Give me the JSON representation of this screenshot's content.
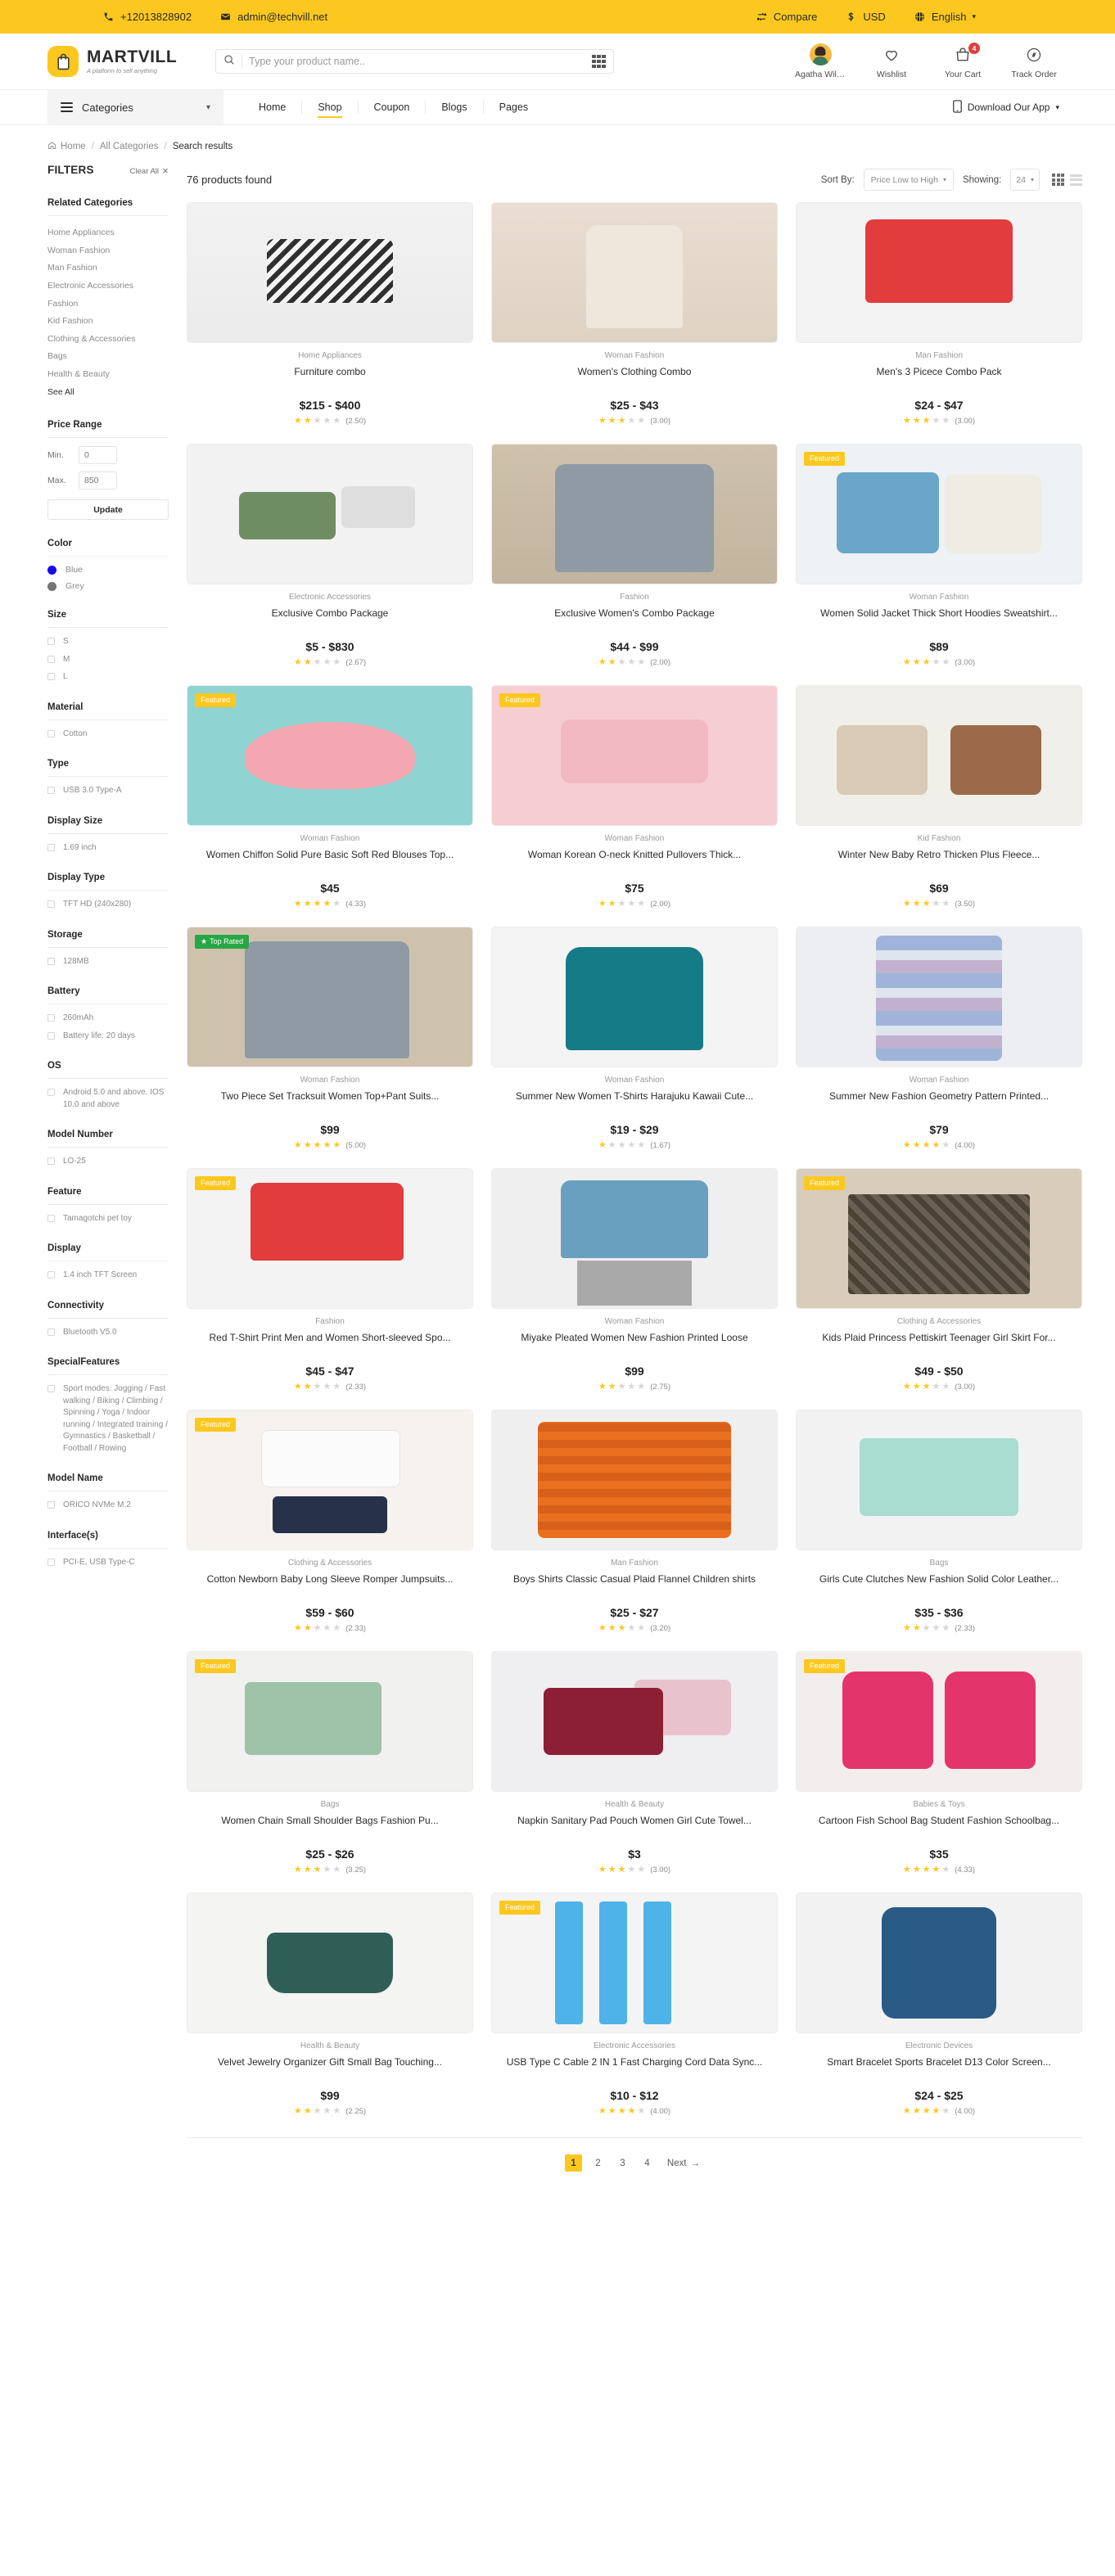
{
  "topbar": {
    "phone": "+12013828902",
    "email": "admin@techvill.net",
    "compare": "Compare",
    "currency": "USD",
    "language": "English"
  },
  "brand": {
    "name": "MARTVILL",
    "tagline": "A platform to sell anything"
  },
  "search": {
    "placeholder": "Type your product name..",
    "value": ""
  },
  "header_actions": [
    {
      "name": "account",
      "label": "Agatha Willia...",
      "icon": "avatar-icon",
      "badge": ""
    },
    {
      "name": "wishlist",
      "label": "Wishlist",
      "icon": "heart-icon",
      "badge": ""
    },
    {
      "name": "cart",
      "label": "Your Cart",
      "icon": "cart-icon",
      "badge": "4"
    },
    {
      "name": "track-order",
      "label": "Track Order",
      "icon": "compass-icon",
      "badge": ""
    }
  ],
  "nav": {
    "categories_label": "Categories",
    "links": [
      {
        "label": "Home",
        "active": false
      },
      {
        "label": "Shop",
        "active": true
      },
      {
        "label": "Coupon",
        "active": false
      },
      {
        "label": "Blogs",
        "active": false
      },
      {
        "label": "Pages",
        "active": false
      }
    ],
    "download_label": "Download Our App"
  },
  "breadcrumb": [
    {
      "label": "Home",
      "current": false
    },
    {
      "label": "All Categories",
      "current": false
    },
    {
      "label": "Search results",
      "current": true
    }
  ],
  "filters": {
    "title": "FILTERS",
    "clear_all": "Clear All",
    "related_categories": {
      "title": "Related Categories",
      "items": [
        "Home Appliances",
        "Woman Fashion",
        "Man Fashion",
        "Electronic Accessories",
        "Fashion",
        "Kid Fashion",
        "Clothing & Accessories",
        "Bags",
        "Health & Beauty"
      ],
      "see_all": "See All"
    },
    "price_range": {
      "title": "Price Range",
      "min_label": "Min.",
      "min_value": "0",
      "max_label": "Max.",
      "max_value": "850",
      "update_label": "Update"
    },
    "color": {
      "title": "Color",
      "items": [
        {
          "label": "Blue",
          "hex": "#1709e8"
        },
        {
          "label": "Grey",
          "hex": "#757575"
        }
      ]
    },
    "groups": [
      {
        "title": "Size",
        "items": [
          "S",
          "M",
          "L"
        ]
      },
      {
        "title": "Material",
        "items": [
          "Cotton"
        ]
      },
      {
        "title": "Type",
        "items": [
          "USB 3.0 Type-A"
        ]
      },
      {
        "title": "Display Size",
        "items": [
          "1.69 inch"
        ]
      },
      {
        "title": "Display Type",
        "items": [
          "TFT HD (240x280)"
        ]
      },
      {
        "title": "Storage",
        "items": [
          "128MB"
        ]
      },
      {
        "title": "Battery",
        "items": [
          "260mAh",
          "Battery life: 20 days"
        ]
      },
      {
        "title": "OS",
        "items": [
          "Android 5.0 and above. IOS 10.0 and above"
        ]
      },
      {
        "title": "Model Number",
        "items": [
          "LO-25"
        ]
      },
      {
        "title": "Feature",
        "items": [
          "Tamagotchi pet toy"
        ]
      },
      {
        "title": "Display",
        "items": [
          "1.4 inch TFT Screen"
        ]
      },
      {
        "title": "Connectivity",
        "items": [
          "Bluetooth V5.0"
        ]
      },
      {
        "title": "SpecialFeatures",
        "items": [
          "Sport modes: Jogging / Fast walking / Biking / Climbing / Spinning / Yoga / Indoor running / Integrated training / Gymnastics / Basketball / Football / Rowing"
        ]
      },
      {
        "title": "Model Name",
        "items": [
          "ORICO NVMe M.2"
        ]
      },
      {
        "title": "Interface(s)",
        "items": [
          "PCI-E, USB Type-C"
        ]
      }
    ]
  },
  "results": {
    "count_label": "76 products found",
    "sort_label": "Sort By:",
    "sort_value": "Price Low to High",
    "showing_label": "Showing:",
    "showing_value": "24"
  },
  "products": [
    {
      "badge": "",
      "category": "Home Appliances",
      "title": "Furniture combo",
      "price": "$215 - $400",
      "stars": 2,
      "rating": "(2.50)",
      "art": "a1"
    },
    {
      "badge": "",
      "category": "Woman Fashion",
      "title": "Women's Clothing Combo",
      "price": "$25 - $43",
      "stars": 3,
      "rating": "(3.00)",
      "art": "a2"
    },
    {
      "badge": "",
      "category": "Man Fashion",
      "title": "Men's 3 Picece Combo Pack",
      "price": "$24 - $47",
      "stars": 3,
      "rating": "(3.00)",
      "art": "a3"
    },
    {
      "badge": "",
      "category": "Electronic Accessories",
      "title": "Exclusive Combo Package",
      "price": "$5 - $830",
      "stars": 2,
      "rating": "(2.67)",
      "art": "a4"
    },
    {
      "badge": "",
      "category": "Fashion",
      "title": "Exclusive Women's Combo Package",
      "price": "$44 - $99",
      "stars": 2,
      "rating": "(2.00)",
      "art": "a5"
    },
    {
      "badge": "Featured",
      "category": "Woman Fashion",
      "title": "Women Solid Jacket Thick Short Hoodies Sweatshirt...",
      "price": "$89",
      "stars": 3,
      "rating": "(3.00)",
      "art": "a6"
    },
    {
      "badge": "Featured",
      "category": "Woman Fashion",
      "title": "Women Chiffon Solid Pure Basic Soft Red Blouses Top...",
      "price": "$45",
      "stars": 4,
      "rating": "(4.33)",
      "art": "a7"
    },
    {
      "badge": "Featured",
      "category": "Woman Fashion",
      "title": "Woman Korean O-neck Knitted Pullovers Thick...",
      "price": "$75",
      "stars": 2,
      "rating": "(2.00)",
      "art": "a8"
    },
    {
      "badge": "",
      "category": "Kid Fashion",
      "title": "Winter New Baby Retro Thicken Plus Fleece...",
      "price": "$69",
      "stars": 3,
      "rating": "(3.50)",
      "art": "a9"
    },
    {
      "badge": "Top Rated",
      "category": "Woman Fashion",
      "title": "Two Piece Set Tracksuit Women Top+Pant Suits...",
      "price": "$99",
      "stars": 5,
      "rating": "(5.00)",
      "art": "a10"
    },
    {
      "badge": "",
      "category": "Woman Fashion",
      "title": "Summer New Women T-Shirts Harajuku Kawaii Cute...",
      "price": "$19 - $29",
      "stars": 1,
      "rating": "(1.67)",
      "art": "a11"
    },
    {
      "badge": "",
      "category": "Woman Fashion",
      "title": "Summer New Fashion Geometry Pattern Printed...",
      "price": "$79",
      "stars": 4,
      "rating": "(4.00)",
      "art": "a12"
    },
    {
      "badge": "Featured",
      "category": "Fashion",
      "title": "Red T-Shirt Print Men and Women Short-sleeved Spo...",
      "price": "$45 - $47",
      "stars": 2,
      "rating": "(2.33)",
      "art": "a13"
    },
    {
      "badge": "",
      "category": "Woman Fashion",
      "title": "Miyake Pleated Women New Fashion Printed Loose",
      "price": "$99",
      "stars": 2,
      "rating": "(2.75)",
      "art": "a14"
    },
    {
      "badge": "Featured",
      "category": "Clothing & Accessories",
      "title": "Kids Plaid Princess Pettiskirt Teenager Girl Skirt For...",
      "price": "$49 - $50",
      "stars": 3,
      "rating": "(3.00)",
      "art": "a15"
    },
    {
      "badge": "Featured",
      "category": "Clothing & Accessories",
      "title": "Cotton Newborn Baby Long Sleeve Romper Jumpsuits...",
      "price": "$59 - $60",
      "stars": 2,
      "rating": "(2.33)",
      "art": "a16"
    },
    {
      "badge": "",
      "category": "Man Fashion",
      "title": "Boys Shirts Classic Casual Plaid Flannel Children shirts",
      "price": "$25 - $27",
      "stars": 3,
      "rating": "(3.20)",
      "art": "a17"
    },
    {
      "badge": "",
      "category": "Bags",
      "title": "Girls Cute Clutches New Fashion Solid Color Leather...",
      "price": "$35 - $36",
      "stars": 2,
      "rating": "(2.33)",
      "art": "a18"
    },
    {
      "badge": "Featured",
      "category": "Bags",
      "title": "Women Chain Small Shoulder Bags Fashion Pu...",
      "price": "$25 - $26",
      "stars": 3,
      "rating": "(3.25)",
      "art": "a19"
    },
    {
      "badge": "",
      "category": "Health & Beauty",
      "title": "Napkin Sanitary Pad Pouch Women Girl Cute Towel...",
      "price": "$3",
      "stars": 3,
      "rating": "(3.00)",
      "art": "a20"
    },
    {
      "badge": "Featured",
      "category": "Babies & Toys",
      "title": "Cartoon Fish School Bag Student Fashion Schoolbag...",
      "price": "$35",
      "stars": 4,
      "rating": "(4.33)",
      "art": "a21"
    },
    {
      "badge": "",
      "category": "Health & Beauty",
      "title": "Velvet Jewelry Organizer Gift Small Bag Touching...",
      "price": "$99",
      "stars": 2,
      "rating": "(2.25)",
      "art": "a22"
    },
    {
      "badge": "Featured",
      "category": "Electronic Accessories",
      "title": "USB Type C Cable 2 IN 1 Fast Charging Cord Data Sync...",
      "price": "$10 - $12",
      "stars": 4,
      "rating": "(4.00)",
      "art": "a23"
    },
    {
      "badge": "",
      "category": "Electronic Devices",
      "title": "Smart Bracelet Sports Bracelet D13 Color Screen...",
      "price": "$24 - $25",
      "stars": 4,
      "rating": "(4.00)",
      "art": "a24"
    }
  ],
  "pagination": {
    "pages": [
      "1",
      "2",
      "3",
      "4"
    ],
    "active": "1",
    "next_label": "Next"
  },
  "colors": {
    "accent": "#fcc81f",
    "star": "#fcc81f",
    "badge_green": "#27a745",
    "badge_red": "#e23c3c"
  }
}
